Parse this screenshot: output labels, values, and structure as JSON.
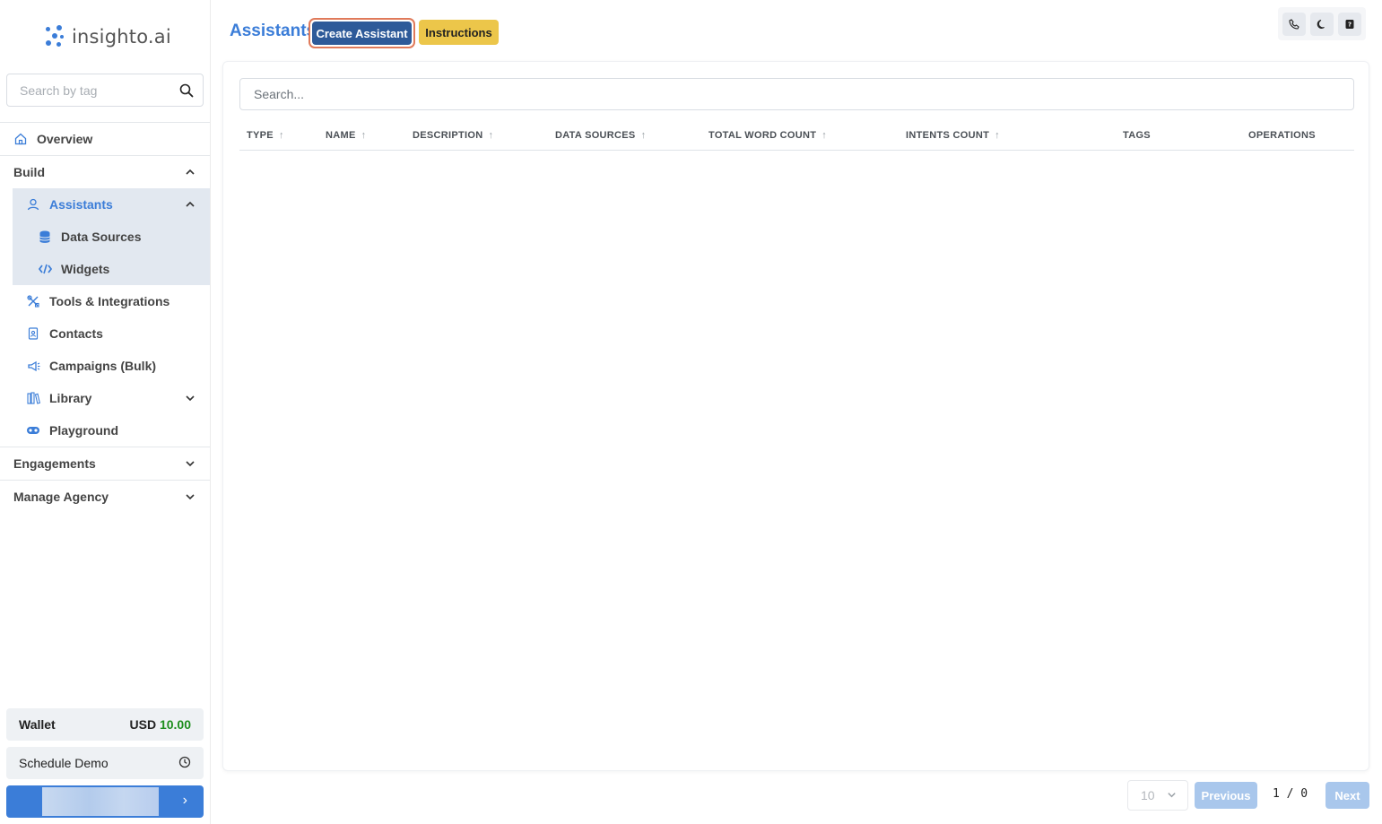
{
  "brand": {
    "name": "insighto.ai",
    "accent": "#3b7dd8"
  },
  "sidebar": {
    "search_placeholder": "Search by tag",
    "overview": "Overview",
    "build": "Build",
    "assistants": "Assistants",
    "data_sources": "Data Sources",
    "widgets": "Widgets",
    "tools": "Tools & Integrations",
    "contacts": "Contacts",
    "campaigns": "Campaigns (Bulk)",
    "library": "Library",
    "playground": "Playground",
    "engagements": "Engagements",
    "manage_agency": "Manage Agency",
    "wallet": {
      "label": "Wallet",
      "currency": "USD",
      "amount": "10.00"
    },
    "schedule_demo": "Schedule Demo",
    "upgrade_arrow": "›"
  },
  "header": {
    "title": "Assistants",
    "create_button": "Create Assistant",
    "instructions_button": "Instructions",
    "icons": [
      "phone-icon",
      "moon-icon",
      "help-icon"
    ]
  },
  "table": {
    "search_placeholder": "Search...",
    "columns": [
      {
        "label": "TYPE",
        "sortable": true
      },
      {
        "label": "NAME",
        "sortable": true
      },
      {
        "label": "DESCRIPTION",
        "sortable": true
      },
      {
        "label": "DATA SOURCES",
        "sortable": true
      },
      {
        "label": "TOTAL WORD COUNT",
        "sortable": true
      },
      {
        "label": "INTENTS COUNT",
        "sortable": true
      },
      {
        "label": "TAGS",
        "sortable": false
      },
      {
        "label": "OPERATIONS",
        "sortable": false
      }
    ],
    "rows": []
  },
  "pagination": {
    "page_size": "10",
    "previous": "Previous",
    "next": "Next",
    "indicator": "1 / 0"
  }
}
